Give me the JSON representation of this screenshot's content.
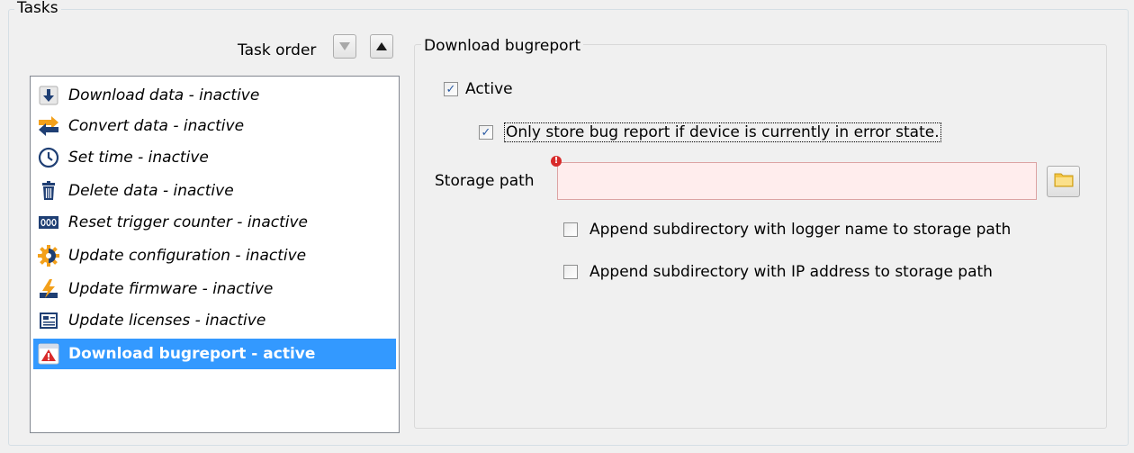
{
  "tasks_group": {
    "title": "Tasks"
  },
  "task_order": {
    "label": "Task order",
    "down_icon": "triangle-down-icon",
    "up_icon": "triangle-up-icon"
  },
  "task_list": {
    "items": [
      {
        "label": "Download data - inactive",
        "icon": "download-arrow-icon"
      },
      {
        "label": "Convert data - inactive",
        "icon": "convert-arrows-icon"
      },
      {
        "label": "Set time - inactive",
        "icon": "clock-icon"
      },
      {
        "label": "Delete data - inactive",
        "icon": "trash-icon"
      },
      {
        "label": "Reset trigger counter - inactive",
        "icon": "counter-icon"
      },
      {
        "label": "Update configuration - inactive",
        "icon": "gear-icon"
      },
      {
        "label": "Update firmware - inactive",
        "icon": "firmware-icon"
      },
      {
        "label": "Update licenses - inactive",
        "icon": "license-icon"
      },
      {
        "label": "Download bugreport - active",
        "icon": "bugreport-icon",
        "selected": true
      }
    ]
  },
  "download_group": {
    "title": "Download bugreport",
    "active_checkbox": {
      "label": "Active",
      "checked": true
    },
    "only_error_checkbox": {
      "label": "Only store bug report if device is currently in error state.",
      "checked": true
    },
    "storage_path": {
      "label": "Storage path",
      "value": "",
      "error_badge": "!"
    },
    "append_logger_checkbox": {
      "label": "Append subdirectory with logger name to storage path",
      "checked": false
    },
    "append_ip_checkbox": {
      "label": "Append subdirectory with IP address to storage path",
      "checked": false
    }
  },
  "colors": {
    "selection": "#3399ff",
    "error_field": "#ffeded",
    "error_badge": "#d82a2a",
    "checkmark": "#2a5aa3"
  }
}
